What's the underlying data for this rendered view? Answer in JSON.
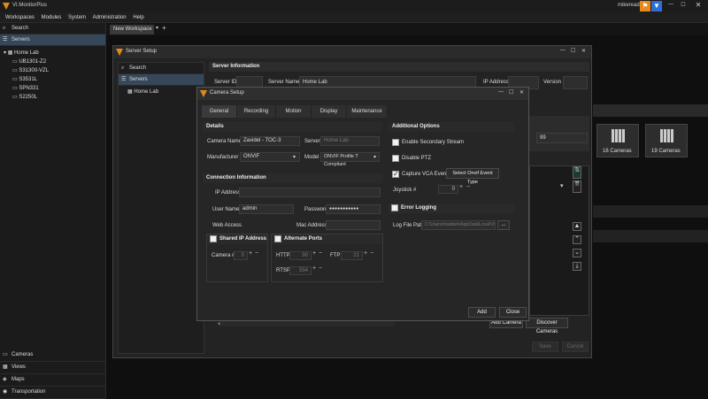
{
  "app": {
    "title": "VI.MonitorPlus",
    "username": "mikereading"
  },
  "menu": [
    "Workspaces",
    "Modules",
    "System",
    "Administration",
    "Help"
  ],
  "workspace_tab": "New Workspace",
  "left_panel": {
    "search": "Search",
    "servers": "Servers",
    "tree_root": "Home Lab",
    "cameras": [
      "UB1301-Z2",
      "S31300-VZL",
      "S3531L",
      "SPN331",
      "S2250L"
    ],
    "bottom": [
      "Cameras",
      "Views",
      "Maps",
      "Transportation"
    ]
  },
  "server_setup": {
    "title": "Server Setup",
    "search": "Search",
    "servers": "Servers",
    "tree_item": "Home Lab",
    "info_header": "Server Information",
    "server_id_label": "Server ID",
    "server_name_label": "Server Name",
    "server_name_value": "Home Lab",
    "ip_label": "IP Address",
    "version_label": "Version",
    "partial_value": "99",
    "tiles": [
      "16 Cameras",
      "19 Cameras"
    ],
    "add_camera": "Add Camera",
    "discover": "Discover Cameras",
    "save": "Save",
    "cancel": "Cancel"
  },
  "camera_setup": {
    "title": "Camera Setup",
    "tabs": [
      "General",
      "Recording",
      "Motion",
      "Display",
      "Maintenance"
    ],
    "details_header": "Details",
    "camera_name_label": "Camera Name",
    "camera_name_value": "Zavidel - TOC-3",
    "server_label": "Server",
    "server_value": "Home Lab",
    "manufacturer_label": "Manufacturer",
    "manufacturer_value": "ONVIF",
    "model_label": "Model",
    "model_value": "ONVIF Profile T Compliant",
    "conn_header": "Connection Information",
    "ip_label": "IP Address",
    "username_label": "User Name",
    "username_value": "admin",
    "password_label": "Password",
    "password_value": "●●●●●●●●●●●",
    "web_access_label": "Web Access",
    "mac_label": "Mac Address",
    "shared_ip": "Shared IP Address",
    "alt_ports": "Alternate Ports",
    "camera_num_label": "Camera #",
    "camera_num_value": "0",
    "http_label": "HTTP",
    "http_value": "90",
    "ftp_label": "FTP",
    "ftp_value": "21",
    "rtsp_label": "RTSP",
    "rtsp_value": "554",
    "additional_header": "Additional Options",
    "secondary_stream": "Enable Secondary Stream",
    "disable_ptz": "Disable PTZ",
    "capture_vca": "Capture VCA Events",
    "select_onvif": "Select Onvif Event Type",
    "joystick_label": "Joystick #",
    "joystick_value": "0",
    "error_logging": "Error Logging",
    "log_path_label": "Log File Path",
    "log_path_value": "C:\\Users\\madden\\AppData\\Local\\Vi",
    "browse": "...",
    "add": "Add",
    "close": "Close"
  }
}
